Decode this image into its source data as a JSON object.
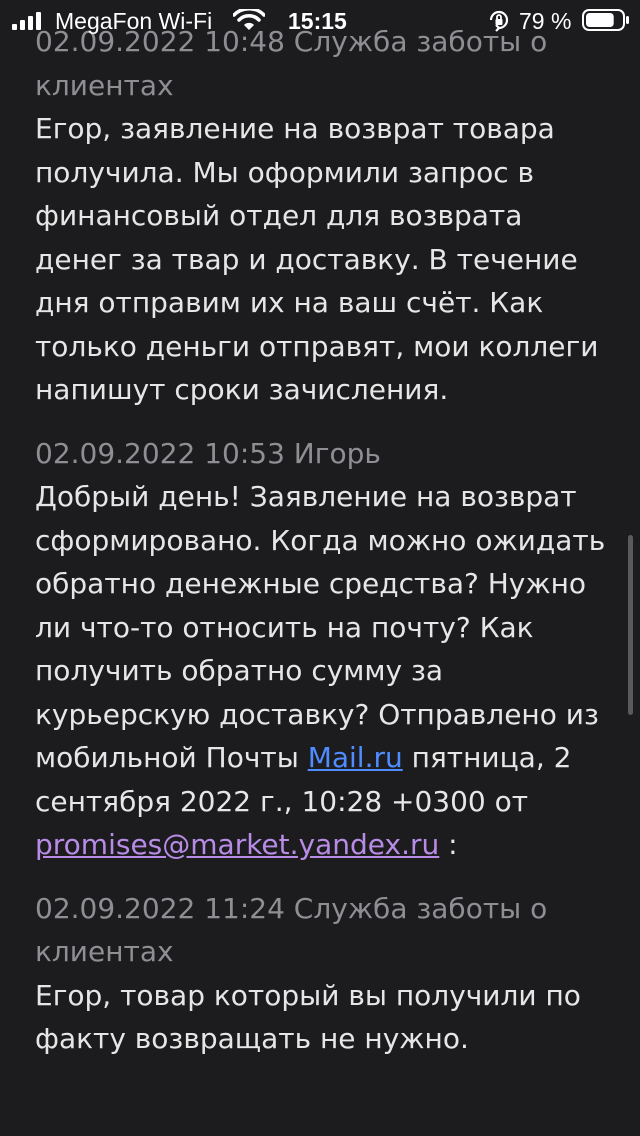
{
  "status_bar": {
    "carrier": "MegaFon Wi-Fi",
    "time": "15:15",
    "battery_percent": "79 %",
    "battery_level": 0.79,
    "icons": [
      "cellular-signal-icon",
      "wifi-icon",
      "rotation-lock-icon",
      "battery-icon"
    ]
  },
  "messages": [
    {
      "meta": "02.09.2022 10:48 Служба заботы о клиентах",
      "body": "Егор, заявление на возврат товара получила. Мы оформили запрос в финансовый отдел для возврата денег за твар и доставку. В течение дня отправим их на ваш счёт. Как только деньги отправят, мои коллеги напишут сроки зачисления."
    },
    {
      "meta": "02.09.2022 10:53 Игорь",
      "body_before_link": "Добрый день! Заявление на возврат сформировано. Когда можно ожидать обратно денежные средства? Нужно ли что-то относить на почту? Как получить обратно сумму за курьерскую доставку? Отправлено из мобильной Почты ",
      "link1": "Mail.ru",
      "body_middle": " пятница, 2 сентября 2022 г., 10:28 +0300 от ",
      "link2": "promises@market.yandex.ru",
      "body_after": " :"
    },
    {
      "meta": "02.09.2022 11:24 Служба заботы о клиентах",
      "body": "Егор, товар который вы получили по факту возвращать не нужно."
    }
  ],
  "colors": {
    "background": "#1c1c1e",
    "text": "#e6e6e6",
    "meta": "#8e8e93",
    "link": "#4e8cff",
    "visited_link": "#b78be6"
  }
}
